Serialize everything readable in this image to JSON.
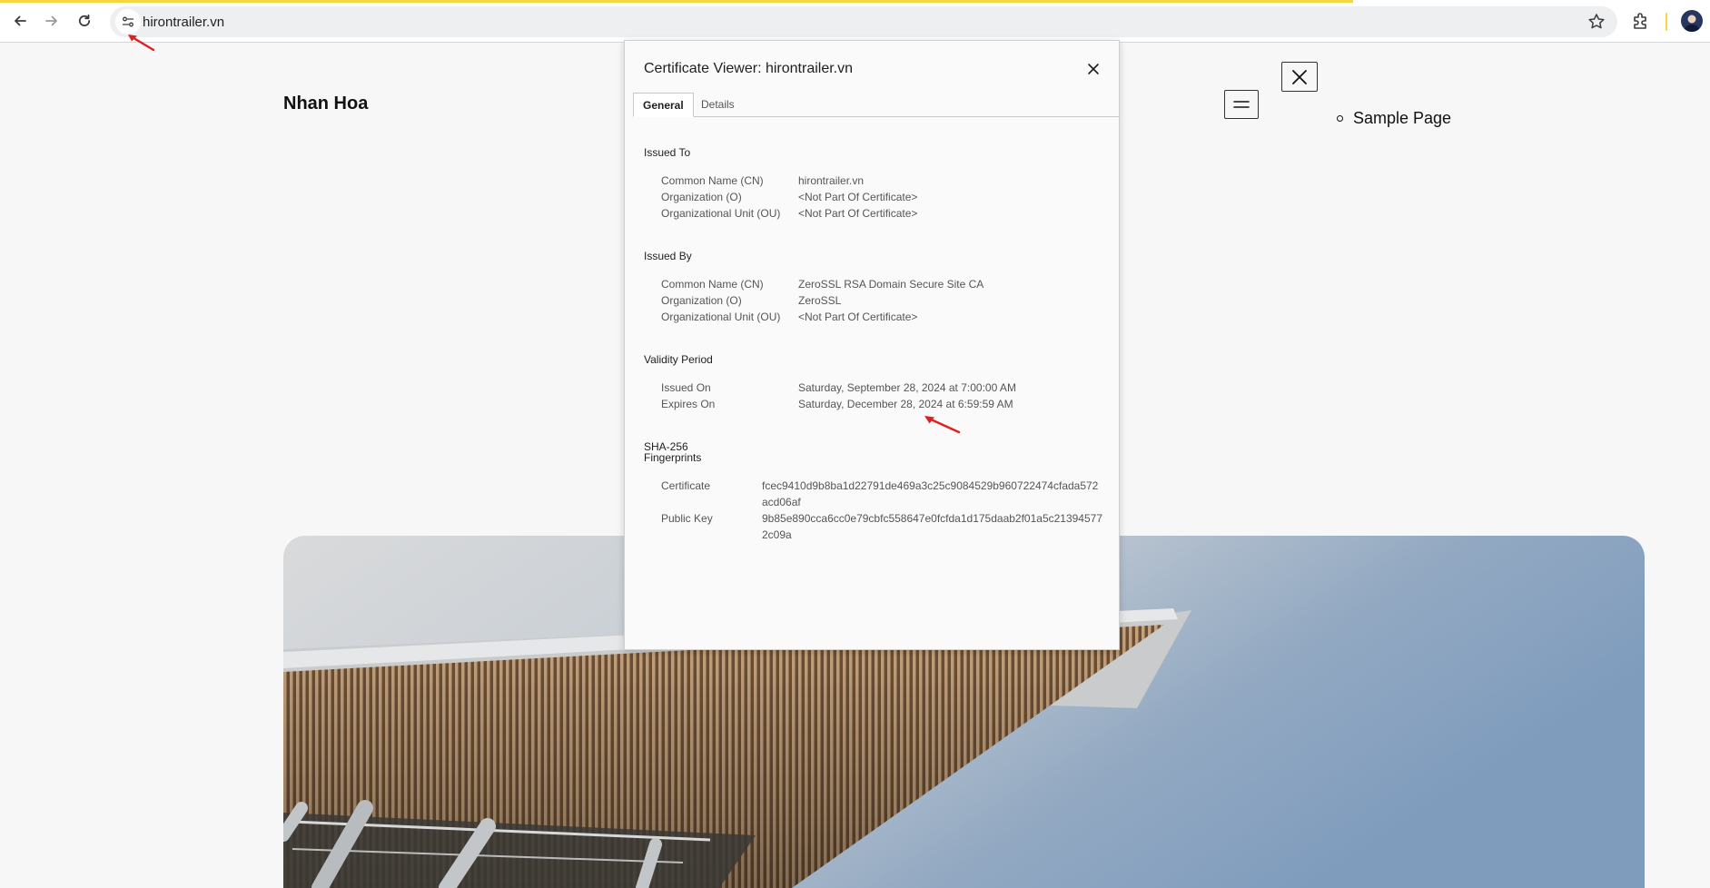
{
  "browser": {
    "url": "hirontrailer.vn",
    "accent_color": "#f4d542"
  },
  "site": {
    "title": "Nhan Hoa",
    "nav_items": [
      "Sample Page"
    ]
  },
  "dialog": {
    "title": "Certificate Viewer: hirontrailer.vn",
    "tabs": [
      "General",
      "Details"
    ],
    "active_tab": "General",
    "issued_to": {
      "heading": "Issued To",
      "cn_label": "Common Name (CN)",
      "cn_value": "hirontrailer.vn",
      "o_label": "Organization (O)",
      "o_value": "<Not Part Of Certificate>",
      "ou_label": "Organizational Unit (OU)",
      "ou_value": "<Not Part Of Certificate>"
    },
    "issued_by": {
      "heading": "Issued By",
      "cn_label": "Common Name (CN)",
      "cn_value": "ZeroSSL RSA Domain Secure Site CA",
      "o_label": "Organization (O)",
      "o_value": "ZeroSSL",
      "ou_label": "Organizational Unit (OU)",
      "ou_value": "<Not Part Of Certificate>"
    },
    "validity": {
      "heading": "Validity Period",
      "issued_label": "Issued On",
      "issued_value": "Saturday, September 28, 2024 at 7:00:00 AM",
      "expires_label": "Expires On",
      "expires_value": "Saturday, December 28, 2024 at 6:59:59 AM"
    },
    "fingerprints": {
      "heading_line1": "SHA-256",
      "heading_line2": "Fingerprints",
      "cert_label": "Certificate",
      "cert_value": "fcec9410d9b8ba1d22791de469a3c25c9084529b960722474cfada572acd06af",
      "pk_label": "Public Key",
      "pk_value": "9b85e890cca6cc0e79cbfc558647e0fcfda1d175daab2f01a5c213945772c09a"
    }
  }
}
